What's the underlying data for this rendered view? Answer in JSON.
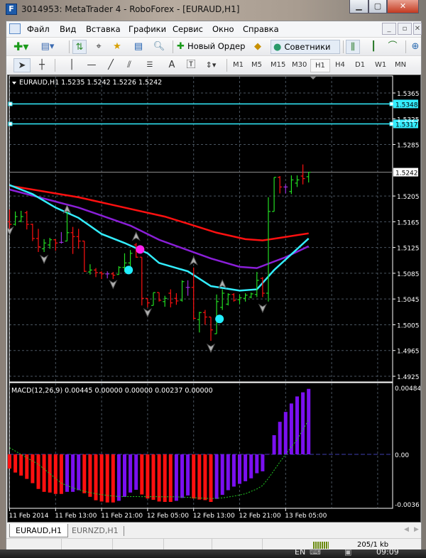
{
  "window": {
    "title": "3014953: MetaTrader 4 - RoboForex - [EURAUD,H1]",
    "buttons": {
      "minimize": "▁",
      "maximize": "▢",
      "close": "✕"
    }
  },
  "menu": {
    "items": [
      "Файл",
      "Вид",
      "Вставка",
      "Графики",
      "Сервис",
      "Окно",
      "Справка"
    ],
    "mdi_buttons": [
      "_",
      "▫",
      "✕"
    ]
  },
  "toolbar1": {
    "new_order_label": "Новый Ордер",
    "experts_label": "Советники",
    "icons": [
      "new-chart-icon",
      "profiles-icon",
      "market-watch-icon",
      "crosshair-navigator-icon",
      "favorites-icon",
      "terminal-icon",
      "tester-icon",
      "new-order-icon",
      "autotrading-icon",
      "experts-icon",
      "bar-chart-icon",
      "candlestick-icon",
      "line-chart-icon",
      "zoom-in-icon"
    ]
  },
  "toolbar2": {
    "text_tool": "A",
    "timeframes": [
      "M1",
      "M5",
      "M15",
      "M30",
      "H1",
      "H4",
      "D1",
      "W1",
      "MN"
    ],
    "active_timeframe": "H1"
  },
  "chart": {
    "header": "EURAUD,H1  1.5235 1.5242 1.5226 1.5242",
    "indicator_header": "MACD(12,26,9) 0.00445 0.00000 0.00000 0.00237 0.00000",
    "colors": {
      "up": "#22dd22",
      "down": "#ff1010",
      "doji": "#9b30e0",
      "ma_red": "#ff1010",
      "ma_purple": "#8a1fd8",
      "ma_cyan": "#33eeff",
      "macd_up": "#7a10f0",
      "macd_down": "#ff1010",
      "signal": "#22cc22",
      "grid": "#4a5560"
    }
  },
  "chart_data": [
    {
      "type": "ohlc",
      "symbol": "EURAUD,H1",
      "ylim": [
        1.4905,
        1.539
      ],
      "yticks": [
        "1.5365",
        "1.5325",
        "1.5285",
        "1.5205",
        "1.5165",
        "1.5125",
        "1.5085",
        "1.5045",
        "1.5005",
        "1.4965",
        "1.4925"
      ],
      "xticks": [
        "11 Feb 2014",
        "11 Feb 13:00",
        "11 Feb 21:00",
        "12 Feb 05:00",
        "12 Feb 13:00",
        "12 Feb 21:00",
        "13 Feb 05:00"
      ],
      "bars": [
        [
          1.5165,
          1.5184,
          1.5149,
          1.5161
        ],
        [
          1.5161,
          1.5181,
          1.5159,
          1.5173
        ],
        [
          1.5166,
          1.5182,
          1.5164,
          1.5173
        ],
        [
          1.5179,
          1.5182,
          1.5153,
          1.5161
        ],
        [
          1.5161,
          1.5162,
          1.5135,
          1.5139
        ],
        [
          1.5139,
          1.5154,
          1.5118,
          1.5126
        ],
        [
          1.5123,
          1.5138,
          1.5118,
          1.5132
        ],
        [
          1.5129,
          1.514,
          1.5123,
          1.5137
        ],
        [
          1.5137,
          1.5138,
          1.512,
          1.5132
        ],
        [
          1.5133,
          1.5149,
          1.5131,
          1.5133
        ],
        [
          1.5135,
          1.5181,
          1.5135,
          1.5148
        ],
        [
          1.5148,
          1.5157,
          1.5115,
          1.5142
        ],
        [
          1.5142,
          1.5154,
          1.5123,
          1.5135
        ],
        [
          1.5135,
          1.5135,
          1.5087,
          1.5088
        ],
        [
          1.5087,
          1.5099,
          1.5083,
          1.509
        ],
        [
          1.509,
          1.5093,
          1.5079,
          1.5086
        ],
        [
          1.5086,
          1.5088,
          1.5076,
          1.5084
        ],
        [
          1.5084,
          1.5088,
          1.5077,
          1.5084
        ],
        [
          1.5084,
          1.5087,
          1.5076,
          1.5082
        ],
        [
          1.5083,
          1.5096,
          1.5083,
          1.5094
        ],
        [
          1.5094,
          1.5116,
          1.5087,
          1.5101
        ],
        [
          1.5101,
          1.5121,
          1.509,
          1.5116
        ],
        [
          1.5129,
          1.5132,
          1.5109,
          1.511
        ],
        [
          1.511,
          1.511,
          1.5035,
          1.5046
        ],
        [
          1.5046,
          1.5046,
          1.5032,
          1.5039
        ],
        [
          1.5035,
          1.5055,
          1.5035,
          1.5055
        ],
        [
          1.5055,
          1.5055,
          1.5041,
          1.5043
        ],
        [
          1.5041,
          1.505,
          1.5033,
          1.5046
        ],
        [
          1.5054,
          1.506,
          1.5032,
          1.5039
        ],
        [
          1.5046,
          1.5054,
          1.5036,
          1.5042
        ],
        [
          1.5043,
          1.5074,
          1.5041,
          1.5072
        ],
        [
          1.5063,
          1.5074,
          1.505,
          1.5063
        ],
        [
          1.5063,
          1.5094,
          1.5013,
          1.5015
        ],
        [
          1.5013,
          1.5025,
          1.4993,
          1.5024
        ],
        [
          1.5024,
          1.5028,
          1.5005,
          1.5017
        ],
        [
          1.5017,
          1.5017,
          1.498,
          1.4997
        ],
        [
          1.4991,
          1.5052,
          1.4991,
          1.5041
        ],
        [
          1.5032,
          1.506,
          1.5028,
          1.5054
        ],
        [
          1.5037,
          1.5054,
          1.5035,
          1.5052
        ],
        [
          1.5052,
          1.5054,
          1.5041,
          1.5043
        ],
        [
          1.5044,
          1.5052,
          1.5037,
          1.5047
        ],
        [
          1.5046,
          1.5054,
          1.5041,
          1.5051
        ],
        [
          1.5048,
          1.5055,
          1.5046,
          1.5053
        ],
        [
          1.5052,
          1.5087,
          1.5048,
          1.5074
        ],
        [
          1.5077,
          1.5079,
          1.5048,
          1.5054
        ],
        [
          1.5054,
          1.5203,
          1.5041,
          1.5181
        ],
        [
          1.5181,
          1.5234,
          1.5181,
          1.5234
        ],
        [
          1.5234,
          1.5236,
          1.5209,
          1.5219
        ],
        [
          1.5219,
          1.5223,
          1.5209,
          1.5219
        ],
        [
          1.5212,
          1.5237,
          1.5208,
          1.523
        ],
        [
          1.5225,
          1.5237,
          1.5219,
          1.523
        ],
        [
          1.5236,
          1.5254,
          1.5223,
          1.5232
        ],
        [
          1.5235,
          1.5242,
          1.5226,
          1.5242
        ]
      ],
      "moving_averages": [
        {
          "color": "#ff1010",
          "points": [
            [
              1,
              1.5221
            ],
            [
              13,
              1.5203
            ],
            [
              21,
              1.5187
            ],
            [
              28,
              1.5173
            ],
            [
              32,
              1.5162
            ],
            [
              37,
              1.5148
            ],
            [
              42,
              1.5138
            ],
            [
              45,
              1.5136
            ],
            [
              48,
              1.514
            ],
            [
              53,
              1.5147
            ]
          ]
        },
        {
          "color": "#8a1fd8",
          "points": [
            [
              1,
              1.5215
            ],
            [
              13,
              1.5187
            ],
            [
              22,
              1.5159
            ],
            [
              27,
              1.5137
            ],
            [
              36,
              1.5108
            ],
            [
              41,
              1.5095
            ],
            [
              44,
              1.5093
            ],
            [
              49,
              1.511
            ],
            [
              53,
              1.5127
            ]
          ]
        },
        {
          "color": "#33eeff",
          "points": [
            [
              1,
              1.5222
            ],
            [
              5,
              1.5208
            ],
            [
              9,
              1.5187
            ],
            [
              13,
              1.5171
            ],
            [
              17,
              1.5146
            ],
            [
              21,
              1.5132
            ],
            [
              25,
              1.5116
            ],
            [
              27,
              1.5101
            ],
            [
              32,
              1.5088
            ],
            [
              36,
              1.5065
            ],
            [
              41,
              1.5058
            ],
            [
              44,
              1.506
            ],
            [
              47,
              1.509
            ],
            [
              53,
              1.5139
            ]
          ]
        }
      ],
      "signal_dots": [
        {
          "color": "#ff22ee",
          "bar": 23.7,
          "price": 1.5122
        },
        {
          "color": "#22eeff",
          "bar": 21.7,
          "price": 1.509
        },
        {
          "color": "#22eeff",
          "bar": 37.5,
          "price": 1.5014
        }
      ],
      "fractals_up": [
        [
          11,
          1.5184
        ],
        [
          23,
          1.5142
        ],
        [
          33,
          1.5104
        ],
        [
          38,
          1.5068
        ]
      ],
      "fractals_down": [
        [
          1,
          1.5151
        ],
        [
          7,
          1.5107
        ],
        [
          19,
          1.5068
        ],
        [
          25,
          1.5024
        ],
        [
          36,
          1.4969
        ],
        [
          45,
          1.5031
        ]
      ],
      "hlines": [
        {
          "price": "1.5348",
          "color": "#33eeff",
          "style": "level"
        },
        {
          "price": "1.5317",
          "color": "#33eeff",
          "style": "level"
        },
        {
          "price": "1.5242",
          "color": "#8c8c8c",
          "style": "bid"
        }
      ]
    },
    {
      "type": "bar",
      "name": "MACD(12,26,9)",
      "ylim": [
        -0.0036,
        0.00484
      ],
      "yticks": [
        "0.00484",
        "0.00",
        "-0.0036"
      ],
      "histogram": [
        -0.00103,
        -0.00132,
        -0.00154,
        -0.00178,
        -0.00209,
        -0.00251,
        -0.00272,
        -0.00277,
        -0.00287,
        -0.00287,
        -0.00272,
        -0.00272,
        -0.0026,
        -0.00282,
        -0.00308,
        -0.00333,
        -0.00342,
        -0.00349,
        -0.00349,
        -0.00337,
        -0.00308,
        -0.00277,
        -0.00257,
        -0.00291,
        -0.0032,
        -0.0033,
        -0.00342,
        -0.00345,
        -0.00345,
        -0.00337,
        -0.00316,
        -0.00298,
        -0.0032,
        -0.00328,
        -0.00332,
        -0.00345,
        -0.00323,
        -0.00294,
        -0.0026,
        -0.00234,
        -0.00214,
        -0.00195,
        -0.00174,
        -0.00137,
        -0.00123,
        2e-05,
        0.00139,
        0.00236,
        0.00308,
        0.00369,
        0.0042,
        0.0045,
        0.00475
      ],
      "histogram_colors": [
        "r",
        "r",
        "r",
        "r",
        "r",
        "r",
        "r",
        "r",
        "r",
        "r",
        "p",
        "p",
        "p",
        "r",
        "r",
        "r",
        "r",
        "r",
        "r",
        "p",
        "p",
        "p",
        "p",
        "r",
        "r",
        "r",
        "r",
        "r",
        "r",
        "p",
        "p",
        "p",
        "r",
        "r",
        "r",
        "r",
        "p",
        "p",
        "p",
        "p",
        "p",
        "p",
        "p",
        "p",
        "p",
        "p",
        "p",
        "p",
        "p",
        "p",
        "p",
        "p",
        "p"
      ],
      "signal": [
        [
          1,
          0.00048
        ],
        [
          3,
          0
        ],
        [
          6,
          -0.00072
        ],
        [
          8,
          -0.0014
        ],
        [
          10,
          -0.00209
        ],
        [
          12,
          -0.00243
        ],
        [
          14,
          -0.00268
        ],
        [
          16,
          -0.00286
        ],
        [
          18,
          -0.00298
        ],
        [
          20,
          -0.00306
        ],
        [
          30,
          -0.00308
        ],
        [
          36,
          -0.00321
        ],
        [
          38,
          -0.00316
        ],
        [
          40,
          -0.00303
        ],
        [
          42,
          -0.00286
        ],
        [
          44,
          -0.00251
        ],
        [
          45,
          -0.00226
        ],
        [
          46,
          -0.00174
        ],
        [
          47,
          -0.00115
        ],
        [
          48,
          -0.00055
        ],
        [
          49,
          0
        ],
        [
          51,
          0.00108
        ],
        [
          53,
          0.0025
        ]
      ]
    }
  ],
  "tabs": [
    {
      "label": "EURAUD,H1",
      "active": true
    },
    {
      "label": "EURNZD,H1",
      "active": false
    }
  ],
  "statusbar": {
    "traffic": "205/1 kb"
  },
  "taskbar": {
    "language": "EN",
    "clock": "09:09"
  }
}
